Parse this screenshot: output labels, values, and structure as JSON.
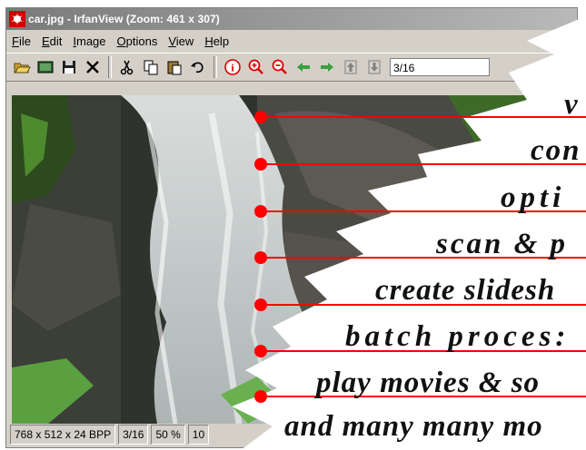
{
  "window": {
    "title": "car.jpg - IrfanView (Zoom: 461 x 307)"
  },
  "menu": {
    "items": [
      {
        "first": "F",
        "rest": "ile"
      },
      {
        "first": "E",
        "rest": "dit"
      },
      {
        "first": "I",
        "rest": "mage"
      },
      {
        "first": "O",
        "rest": "ptions"
      },
      {
        "first": "V",
        "rest": "iew"
      },
      {
        "first": "H",
        "rest": "elp"
      }
    ]
  },
  "toolbar": {
    "page_value": "3/16"
  },
  "status": {
    "dimensions": "768 x 512 x 24 BPP",
    "page": "3/16",
    "zoom": "50 %",
    "extra": "10"
  },
  "features": [
    "v",
    "con",
    "opti",
    "scan & p",
    "create slidesh",
    "batch proces:",
    "play movies & so",
    "and many many mo"
  ],
  "colors": {
    "accent_red": "#ff0000",
    "window_gray": "#d4d0c8"
  }
}
